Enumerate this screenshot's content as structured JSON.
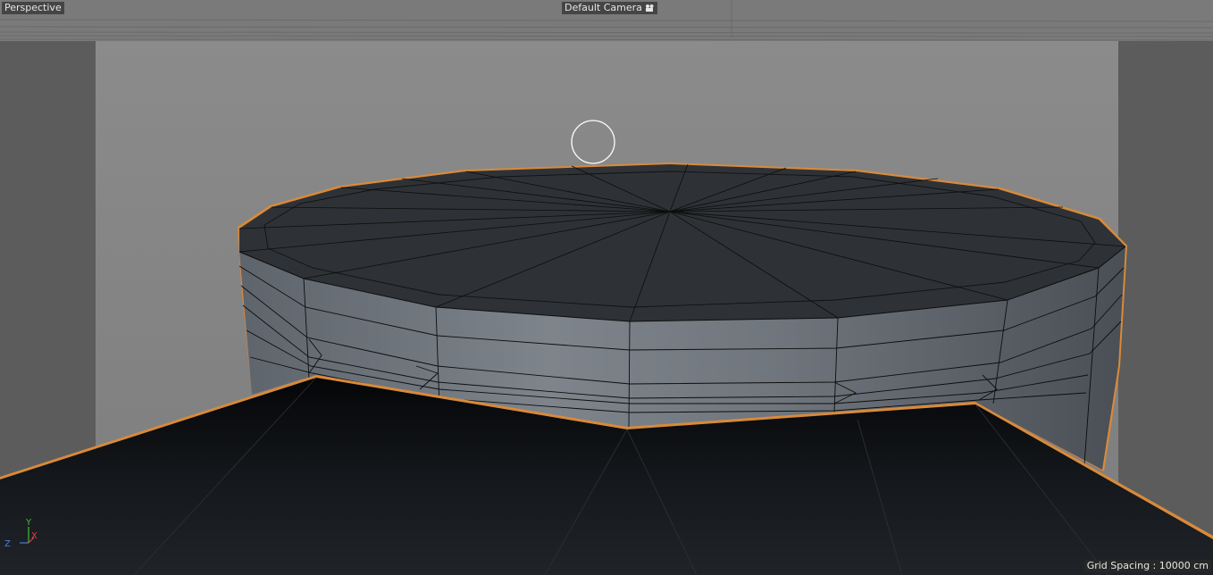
{
  "viewport": {
    "view_name": "Perspective",
    "camera_name": "Default Camera",
    "camera_icon": "camera-icon",
    "grid_spacing_label": "Grid Spacing : 10000 cm"
  },
  "axes": {
    "y": "Y",
    "x": "X",
    "z": "Z"
  },
  "colors": {
    "background": "#8a8a8a",
    "side_panels": "#5e5e5e",
    "selection_outline": "#d98a3a",
    "axis_y": "#3fbf3f",
    "axis_x": "#e04040",
    "axis_z": "#4a7fd8",
    "cursor": "#ffffff"
  }
}
